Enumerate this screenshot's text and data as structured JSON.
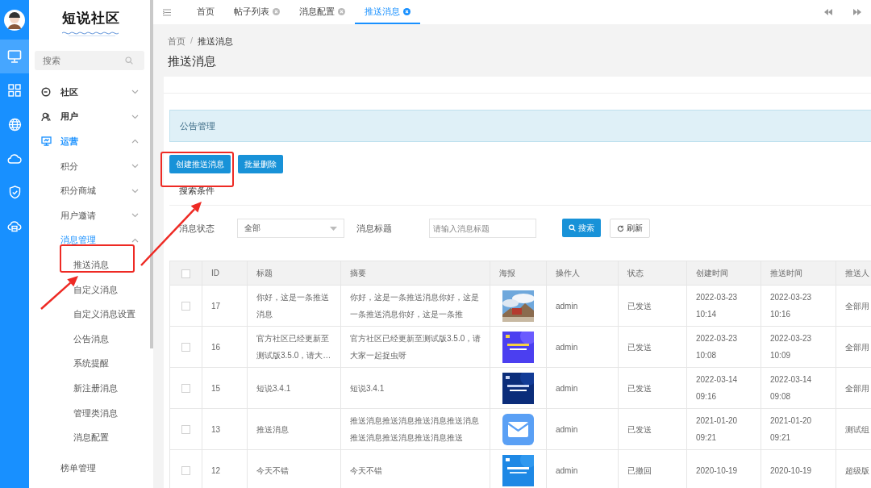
{
  "rail": {
    "items": [
      {
        "selected": true
      },
      {
        "selected": false
      },
      {
        "selected": false
      },
      {
        "selected": false
      },
      {
        "selected": false
      },
      {
        "selected": false
      }
    ]
  },
  "logo": {
    "title": "短说社区"
  },
  "sidebar": {
    "search": {
      "placeholder": "搜索"
    },
    "items": [
      {
        "label": "社区",
        "expanded": false
      },
      {
        "label": "用户",
        "expanded": false
      },
      {
        "label": "运营",
        "expanded": true,
        "children": [
          {
            "label": "积分",
            "expanded": false
          },
          {
            "label": "积分商城",
            "expanded": false
          },
          {
            "label": "用户邀请",
            "expanded": false
          },
          {
            "label": "消息管理",
            "expanded": true,
            "children": [
              {
                "label": "推送消息"
              },
              {
                "label": "自定义消息"
              },
              {
                "label": "自定义消息设置"
              },
              {
                "label": "公告消息"
              },
              {
                "label": "系统提醒"
              },
              {
                "label": "新注册消息"
              },
              {
                "label": "管理类消息"
              },
              {
                "label": "消息配置"
              }
            ]
          },
          {
            "label": "榜单管理"
          }
        ]
      }
    ]
  },
  "tabs": [
    {
      "label": "首页",
      "closable": false,
      "selected": false
    },
    {
      "label": "帖子列表",
      "closable": true,
      "selected": false
    },
    {
      "label": "消息配置",
      "closable": true,
      "selected": false
    },
    {
      "label": "推送消息",
      "closable": true,
      "selected": true
    }
  ],
  "breadcrumb": {
    "items": [
      "首页",
      "推送消息"
    ],
    "separator": "/"
  },
  "page_title": "推送消息",
  "notice": "公告管理",
  "actions": [
    {
      "label": "创建推送消息"
    },
    {
      "label": "批量删除"
    }
  ],
  "search_title": "搜索条件",
  "filters": {
    "status_label": "消息状态",
    "status_value": "全部",
    "title_label": "消息标题",
    "title_placeholder": "请输入消息标题",
    "buttons": [
      {
        "label": "搜索",
        "kind": "primary"
      },
      {
        "label": "刷新",
        "kind": "default"
      }
    ]
  },
  "table": {
    "select_all": {
      "checked": false
    },
    "columns": [
      "ID",
      "标题",
      "摘要",
      "海报",
      "操作人",
      "状态",
      "创建时间",
      "推送时间",
      "推送人"
    ],
    "rows": [
      {
        "checked": false,
        "id": "17",
        "title": "你好，这是一条推送消息",
        "summary": "你好，这是一条推送消息你好，这是一条推送消息你好，这是一条推",
        "operator": "admin",
        "status": "已发送",
        "created": "2022-03-23 10:14",
        "pushed": "2022-03-23 10:16",
        "recipients": "全部用"
      },
      {
        "checked": false,
        "id": "16",
        "title": "官方社区已经更新至测试版3.5.0，请大…",
        "summary": "官方社区已经更新至测试版3.5.0，请大家一起捉虫呀",
        "operator": "admin",
        "status": "已发送",
        "created": "2022-03-23 10:08",
        "pushed": "2022-03-23 10:09",
        "recipients": "全部用"
      },
      {
        "checked": false,
        "id": "15",
        "title": "短说3.4.1",
        "summary": "短说3.4.1",
        "operator": "admin",
        "status": "已发送",
        "created": "2022-03-14 09:16",
        "pushed": "2022-03-14 09:08",
        "recipients": "全部用"
      },
      {
        "checked": false,
        "id": "13",
        "title": "推送消息",
        "summary": "推送消息推送消息推送消息推送消息推送消息推送消息推送消息推送",
        "poster": {
          "kind": "mail"
        },
        "operator": "admin",
        "status": "已发送",
        "created": "2021-01-20 09:21",
        "pushed": "2021-01-20 09:21",
        "recipients": "测试组"
      },
      {
        "checked": false,
        "id": "12",
        "title": "今天不错",
        "summary": "今天不错",
        "operator": "admin",
        "status": "已撤回",
        "created": "2020-10-19",
        "pushed": "2020-10-19",
        "recipients": "超级版"
      }
    ]
  }
}
